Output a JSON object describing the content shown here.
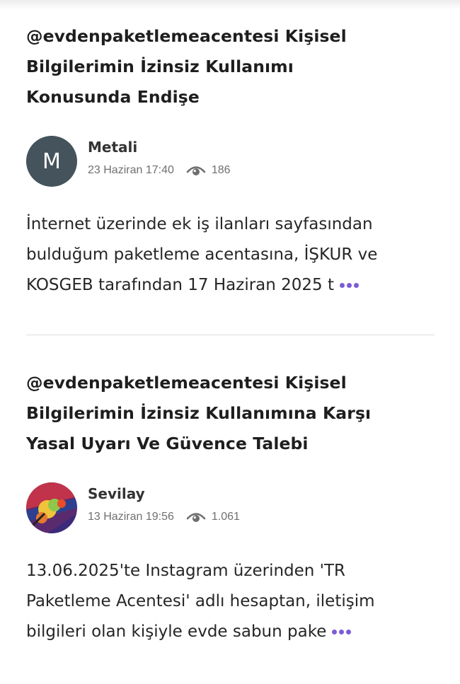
{
  "posts": [
    {
      "title_lines": [
        "@evdenpaketlemeacentesi Kişisel",
        "Bilgilerimin İzinsiz Kullanımı",
        "Konusunda Endişe"
      ],
      "author": "Metali",
      "avatar_initial": "M",
      "date": "23 Haziran 17:40",
      "views": "186",
      "excerpt_lines": [
        "İnternet üzerinde ek iş ilanları sayfasından",
        "bulduğum paketleme acentasına, İŞKUR ve",
        "KOSGEB tarafından 17 Haziran 2025 t"
      ]
    },
    {
      "title_lines": [
        "@evdenpaketlemeacentesi Kişisel",
        "Bilgilerimin İzinsiz Kullanımına Karşı",
        "Yasal Uyarı Ve Güvence Talebi"
      ],
      "author": "Sevilay",
      "date": "13 Haziran 19:56",
      "views": "1.061",
      "excerpt_lines": [
        "13.06.2025'te Instagram üzerinden 'TR",
        "Paketleme Acentesi' adlı hesaptan, iletişim",
        "bilgileri olan kişiyle evde sabun pake"
      ]
    }
  ],
  "icons": {
    "views": "eye-icon",
    "read_more": "more-dots-icon"
  },
  "colors": {
    "accent": "#7b5cd6",
    "avatar_bg": "#44535c",
    "meta": "#707070",
    "divider": "#dedede"
  }
}
